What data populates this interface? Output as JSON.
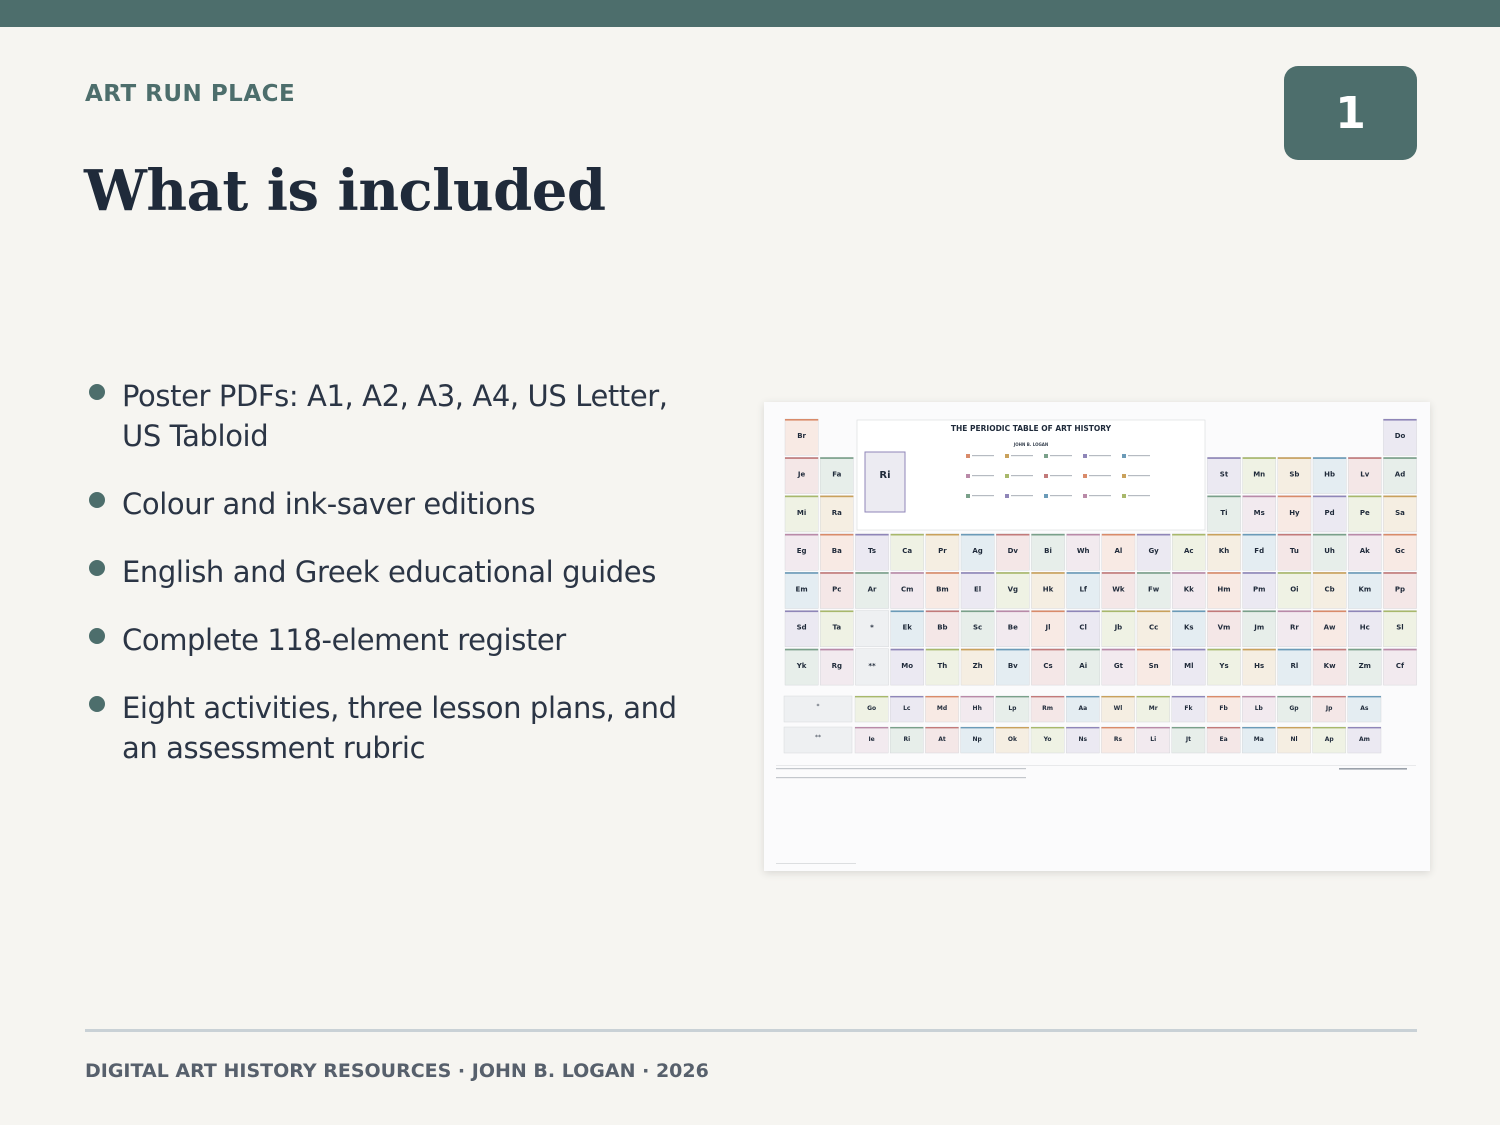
{
  "header": {
    "kicker": "ART RUN PLACE",
    "title": "What is included",
    "slide_number": "1",
    "accent_color": "#4d6e6c"
  },
  "bullets": [
    "Poster PDFs: A1, A2, A3, A4, US Letter, US Tabloid",
    "Colour and ink-saver editions",
    "English and Greek educational guides",
    "Complete 118-element register",
    "Eight activities, three lesson plans, and an assessment rubric"
  ],
  "poster": {
    "title": "THE PERIODIC TABLE OF ART HISTORY",
    "author": "JOHN B. LOGAN",
    "feature_symbol": "Ri",
    "rows": [
      [
        "Br",
        "",
        "",
        "",
        "",
        "",
        "",
        "",
        "",
        "",
        "",
        "",
        "",
        "",
        "",
        "",
        "",
        "Do"
      ],
      [
        "Je",
        "Fa",
        "",
        "",
        "",
        "",
        "",
        "",
        "",
        "",
        "",
        "",
        "St",
        "Mn",
        "Sb",
        "Hb",
        "Lv",
        "Ad"
      ],
      [
        "Mi",
        "Ra",
        "",
        "",
        "",
        "",
        "",
        "",
        "",
        "",
        "",
        "",
        "Ti",
        "Ms",
        "Hy",
        "Pd",
        "Pe",
        "Sa"
      ],
      [
        "Eg",
        "Ba",
        "Ts",
        "Ca",
        "Pr",
        "Ag",
        "Dv",
        "Bi",
        "Wh",
        "Al",
        "Gy",
        "Ac",
        "Kh",
        "Fd",
        "Tu",
        "Uh",
        "Ak",
        "Gc"
      ],
      [
        "Em",
        "Pc",
        "Ar",
        "Cm",
        "Bm",
        "El",
        "Vg",
        "Hk",
        "Lf",
        "Wk",
        "Fw",
        "Kk",
        "Hm",
        "Pm",
        "Oi",
        "Cb",
        "Km",
        "Pp"
      ],
      [
        "Sd",
        "Ta",
        "*",
        "Ek",
        "Bb",
        "Sc",
        "Be",
        "Jl",
        "Cl",
        "Jb",
        "Cc",
        "Ks",
        "Vm",
        "Jm",
        "Rr",
        "Aw",
        "Hc",
        "Sl"
      ],
      [
        "Yk",
        "Rg",
        "**",
        "Mo",
        "Th",
        "Zh",
        "Bv",
        "Cs",
        "Ai",
        "Gt",
        "Sn",
        "Ml",
        "Ys",
        "Hs",
        "Rl",
        "Kw",
        "Zm",
        "Cf"
      ]
    ],
    "series_a": [
      "Go",
      "Lc",
      "Md",
      "Hh",
      "Lp",
      "Rm",
      "Aa",
      "Wl",
      "Mr",
      "Fk",
      "Fb",
      "Lb",
      "Gp",
      "Jp",
      "As"
    ],
    "series_b": [
      "Ie",
      "Ri",
      "At",
      "Np",
      "Ok",
      "Yo",
      "Ns",
      "Rs",
      "Li",
      "Jt",
      "Ea",
      "Ma",
      "Nl",
      "Ap",
      "Am"
    ],
    "series_a_marker": "*",
    "series_b_marker": "**",
    "palette": [
      "#d98b6a",
      "#c9a15c",
      "#7aa08a",
      "#8f86b8",
      "#6b9bb8",
      "#b98aa8",
      "#a8b86b",
      "#c27a7a"
    ]
  },
  "footer": {
    "text": "DIGITAL ART HISTORY RESOURCES · JOHN B. LOGAN · 2026"
  }
}
